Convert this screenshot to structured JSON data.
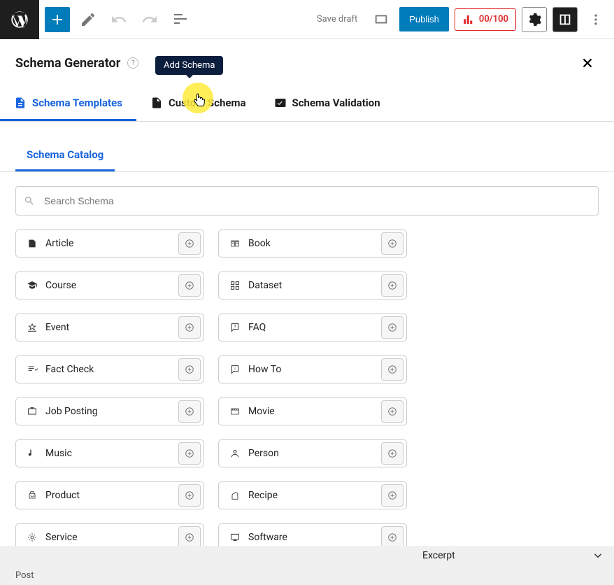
{
  "toolbar": {
    "save_draft": "Save draft",
    "publish": "Publish",
    "rank_score": "00/100"
  },
  "modal": {
    "title": "Schema Generator",
    "tabs": [
      {
        "label": "Schema Templates"
      },
      {
        "label": "Custom Schema"
      },
      {
        "label": "Schema Validation"
      }
    ],
    "sub_tab": "Schema Catalog",
    "search_placeholder": "Search Schema",
    "tooltip": "Add Schema",
    "cards": [
      {
        "label": "Article"
      },
      {
        "label": "Book"
      },
      {
        "label": "Course"
      },
      {
        "label": "Dataset"
      },
      {
        "label": "Event"
      },
      {
        "label": "FAQ"
      },
      {
        "label": "Fact Check"
      },
      {
        "label": "How To"
      },
      {
        "label": "Job Posting"
      },
      {
        "label": "Movie"
      },
      {
        "label": "Music"
      },
      {
        "label": "Person"
      },
      {
        "label": "Product"
      },
      {
        "label": "Recipe"
      },
      {
        "label": "Service"
      },
      {
        "label": "Software"
      }
    ]
  },
  "bottom": {
    "excerpt": "Excerpt",
    "post": "Post"
  }
}
